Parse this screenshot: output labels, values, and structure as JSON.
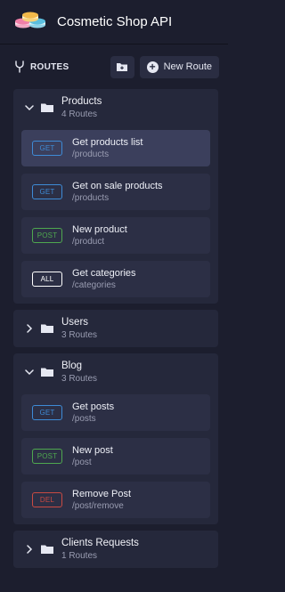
{
  "app": {
    "title": "Cosmetic Shop API"
  },
  "toolbar": {
    "routes_label": "ROUTES",
    "new_route_label": "New Route"
  },
  "colors": {
    "GET": "#3e8bd6",
    "POST": "#4fa84f",
    "ALL": "#ffffff",
    "DEL": "#c94a42"
  },
  "groups": [
    {
      "name": "Products",
      "count": "4 Routes",
      "expanded": true,
      "routes": [
        {
          "method": "GET",
          "name": "Get products list",
          "path": "/products",
          "active": true
        },
        {
          "method": "GET",
          "name": "Get on sale products",
          "path": "/products"
        },
        {
          "method": "POST",
          "name": "New product",
          "path": "/product"
        },
        {
          "method": "ALL",
          "name": "Get categories",
          "path": "/categories"
        }
      ]
    },
    {
      "name": "Users",
      "count": "3 Routes",
      "expanded": false,
      "routes": []
    },
    {
      "name": "Blog",
      "count": "3 Routes",
      "expanded": true,
      "routes": [
        {
          "method": "GET",
          "name": "Get posts",
          "path": "/posts"
        },
        {
          "method": "POST",
          "name": "New post",
          "path": "/post"
        },
        {
          "method": "DEL",
          "name": "Remove Post",
          "path": "/post/remove"
        }
      ]
    },
    {
      "name": "Clients Requests",
      "count": "1 Routes",
      "expanded": false,
      "routes": []
    }
  ]
}
